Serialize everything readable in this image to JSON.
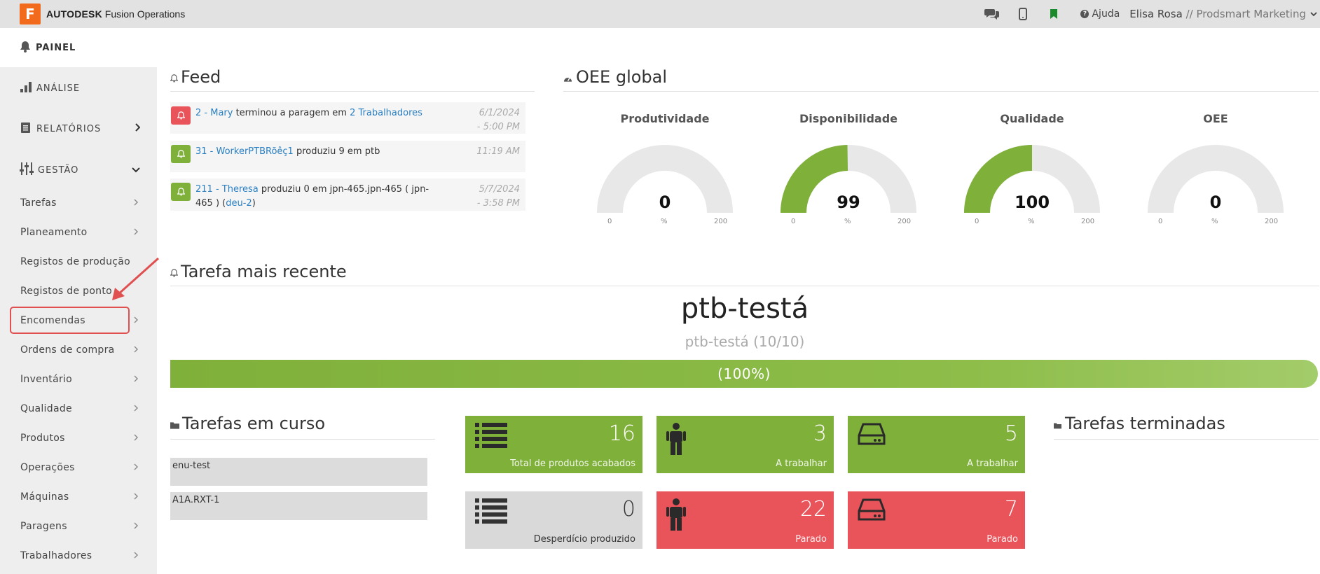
{
  "topbar": {
    "logo_letter": "F",
    "brand_bold": "AUTODESK",
    "brand_rest": " Fusion Operations",
    "icons": [
      "chat-icon",
      "mobile-icon",
      "bookmark-icon"
    ],
    "help_label": "Ajuda",
    "user_name": "Elisa Rosa",
    "user_sep": " // ",
    "user_company": "Prodsmart Marketing"
  },
  "painel": {
    "label": "PAINEL"
  },
  "sidebar": {
    "sections": [
      {
        "label": "ANÁLISE"
      },
      {
        "label": "RELATÓRIOS"
      },
      {
        "label": "GESTÃO"
      }
    ],
    "items": [
      {
        "label": "Tarefas"
      },
      {
        "label": "Planeamento"
      },
      {
        "label": "Registos de produção"
      },
      {
        "label": "Registos de ponto"
      },
      {
        "label": "Encomendas"
      },
      {
        "label": "Ordens de compra"
      },
      {
        "label": "Inventário"
      },
      {
        "label": "Qualidade"
      },
      {
        "label": "Produtos"
      },
      {
        "label": "Operações"
      },
      {
        "label": "Máquinas"
      },
      {
        "label": "Paragens"
      },
      {
        "label": "Trabalhadores"
      }
    ]
  },
  "feed": {
    "title": "Feed",
    "items": [
      {
        "color": "#e9535a",
        "link1": "2 - Mary",
        "text": " terminou a paragem em ",
        "link2": "2 Trabalhadores",
        "tail": "",
        "time1": "6/1/2024",
        "time2": "- 5:00 PM"
      },
      {
        "color": "#7fb03a",
        "link1": "31 - WorkerPTBRõêç1",
        "text": " produziu 9 em ptb",
        "link2": "",
        "tail": "",
        "time1": "11:19 AM",
        "time2": ""
      },
      {
        "color": "#7fb03a",
        "link1": "211 - Theresa",
        "text": " produziu 0 em jpn-465.jpn-465 ( jpn-465 ) (",
        "link2": "deu-2",
        "tail": ")",
        "time1": "5/7/2024",
        "time2": "- 3:58 PM"
      }
    ]
  },
  "oee": {
    "title": "OEE global",
    "gauges": [
      {
        "label": "Produtividade",
        "value": "0",
        "fraction": 0,
        "min": "0",
        "max": "200",
        "unit": "%"
      },
      {
        "label": "Disponibilidade",
        "value": "99",
        "fraction": 0.495,
        "min": "0",
        "max": "200",
        "unit": "%"
      },
      {
        "label": "Qualidade",
        "value": "100",
        "fraction": 0.5,
        "min": "0",
        "max": "200",
        "unit": "%"
      },
      {
        "label": "OEE",
        "value": "0",
        "fraction": 0,
        "min": "0",
        "max": "200",
        "unit": "%"
      }
    ]
  },
  "recent": {
    "title": "Tarefa mais recente",
    "task_name": "ptb-testá",
    "task_sub": "ptb-testá (10/10)",
    "progress_text": "(100%)",
    "progress": 1.0
  },
  "current": {
    "title": "Tarefas em curso",
    "items": [
      "enu-test",
      "A1A.RXT-1"
    ]
  },
  "tiles": [
    {
      "value": "16",
      "caption": "Total de produtos acabados",
      "icon": "list-icon",
      "color": "green"
    },
    {
      "value": "3",
      "caption": "A trabalhar",
      "icon": "worker-icon",
      "color": "green"
    },
    {
      "value": "5",
      "caption": "A trabalhar",
      "icon": "machine-icon",
      "color": "green"
    },
    {
      "value": "0",
      "caption": "Desperdício produzido",
      "icon": "list-icon",
      "color": "grey"
    },
    {
      "value": "22",
      "caption": "Parado",
      "icon": "worker-icon",
      "color": "red"
    },
    {
      "value": "7",
      "caption": "Parado",
      "icon": "machine-icon",
      "color": "red"
    }
  ],
  "finished": {
    "title": "Tarefas terminadas"
  }
}
